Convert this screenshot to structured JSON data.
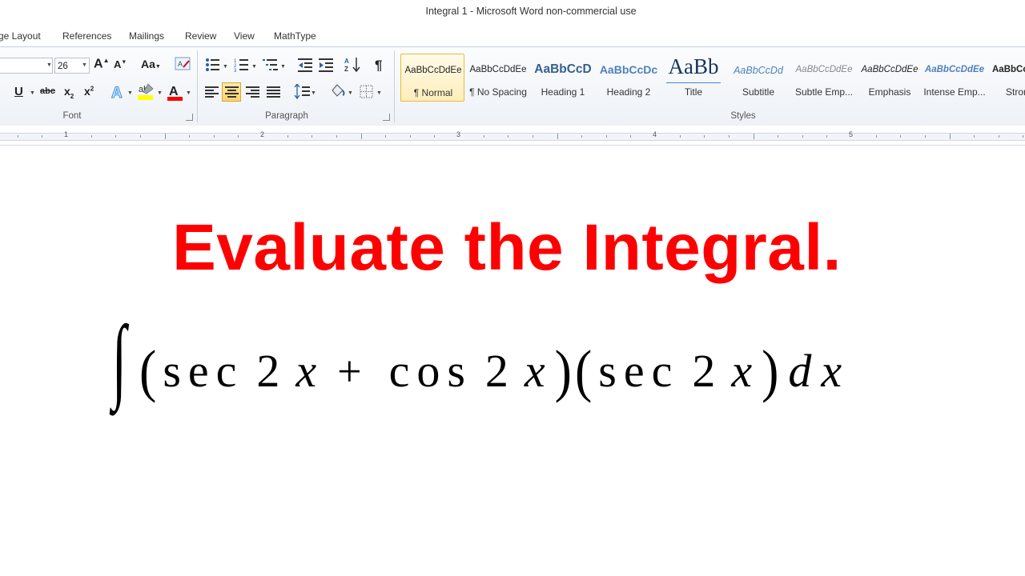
{
  "window": {
    "title": "Integral 1  -  Microsoft Word non-commercial use"
  },
  "tabs": [
    "ge Layout",
    "References",
    "Mailings",
    "Review",
    "View",
    "MathType"
  ],
  "font_group": {
    "label": "Font",
    "size_value": "26"
  },
  "paragraph_group": {
    "label": "Paragraph"
  },
  "styles_group": {
    "label": "Styles",
    "items": [
      {
        "sample": "AaBbCcDdEe",
        "name": "¶ Normal"
      },
      {
        "sample": "AaBbCcDdEe",
        "name": "¶ No Spacing"
      },
      {
        "sample": "AaBbCcD",
        "name": "Heading 1"
      },
      {
        "sample": "AaBbCcDc",
        "name": "Heading 2"
      },
      {
        "sample": "AaBb",
        "name": "Title"
      },
      {
        "sample": "AaBbCcDd",
        "name": "Subtitle"
      },
      {
        "sample": "AaBbCcDdEe",
        "name": "Subtle Emp..."
      },
      {
        "sample": "AaBbCcDdEe",
        "name": "Emphasis"
      },
      {
        "sample": "AaBbCcDdEe",
        "name": "Intense Emp..."
      },
      {
        "sample": "AaBbCc",
        "name": "Stron"
      }
    ],
    "selected": "¶ Normal"
  },
  "ruler": {
    "numbers": [
      "1",
      "2",
      "3",
      "4",
      "5"
    ]
  },
  "document": {
    "heading": "Evaluate the Integral.",
    "heading_color": "#ff0000",
    "equation": {
      "integral": "∫",
      "open1": "(",
      "sec1": "sec",
      "two1": "2",
      "x1": "x",
      "plus": "+",
      "cos": "cos",
      "two2": "2",
      "x2": "x",
      "close1": ")",
      "open2": "(",
      "sec2": "sec",
      "two3": "2",
      "x3": "x",
      "close2": ")",
      "d": "d",
      "x4": "x"
    }
  },
  "colors": {
    "accent_selected_style": "#e9b941",
    "highlight_yellow": "#ffff00",
    "font_color_red": "#ff0000"
  }
}
